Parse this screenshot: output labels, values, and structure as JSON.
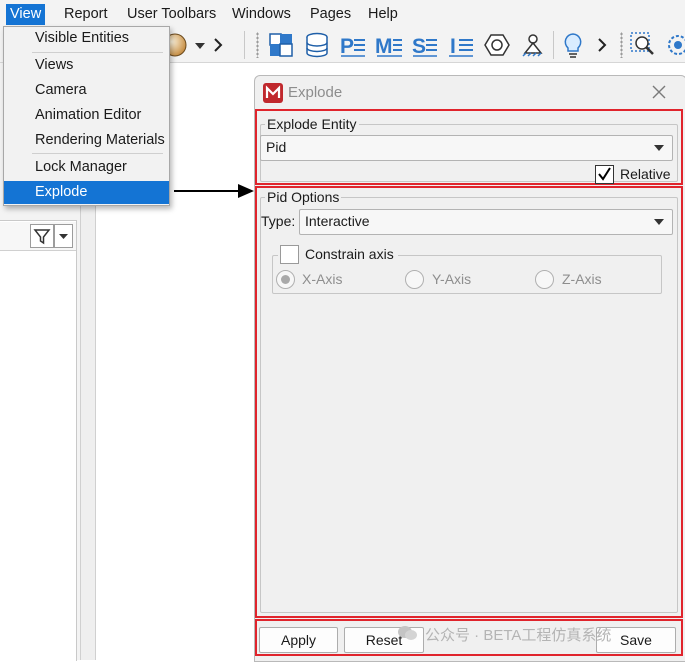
{
  "menubar": {
    "items": [
      {
        "label": "View"
      },
      {
        "label": "Report"
      },
      {
        "label": "User Toolbars"
      },
      {
        "label": "Windows"
      },
      {
        "label": "Pages"
      },
      {
        "label": "Help"
      }
    ]
  },
  "toolbar": {
    "icons": [
      "sphere-shading-icon",
      "dropdown-caret-icon",
      "chevron-right-icon",
      "parts-blocks-icon",
      "database-icon",
      "p-entity-icon",
      "m-entity-icon",
      "s-entity-icon",
      "i-entity-icon",
      "nut-hexagon-icon",
      "pin-support-icon",
      "lightbulb-icon",
      "chevron-right-icon",
      "zoom-window-icon",
      "refresh-view-icon"
    ]
  },
  "view_menu": {
    "items": [
      {
        "label": "Visible Entities"
      },
      {
        "label": "Views"
      },
      {
        "label": "Camera"
      },
      {
        "label": "Animation Editor"
      },
      {
        "label": "Rendering Materials"
      },
      {
        "label": "Lock Manager"
      },
      {
        "label": "Explode",
        "selected": true
      }
    ]
  },
  "dialog": {
    "title": "Explode",
    "explode_entity": {
      "group_label": "Explode Entity",
      "selected": "Pid",
      "relative_label": "Relative",
      "relative_checked": true
    },
    "pid_options": {
      "group_label": "Pid Options",
      "type_label": "Type:",
      "type_value": "Interactive",
      "constrain_label": "Constrain axis",
      "constrain_checked": false,
      "axes": [
        {
          "label": "X-Axis",
          "selected": true
        },
        {
          "label": "Y-Axis",
          "selected": false
        },
        {
          "label": "Z-Axis",
          "selected": false
        }
      ]
    },
    "buttons": {
      "apply": "Apply",
      "reset": "Reset",
      "save": "Save"
    }
  },
  "watermark": "公众号 · BETA工程仿真系统",
  "colors": {
    "accent": "#1474d4",
    "highlight_box": "#e0242c",
    "brand": "#c0282d"
  }
}
